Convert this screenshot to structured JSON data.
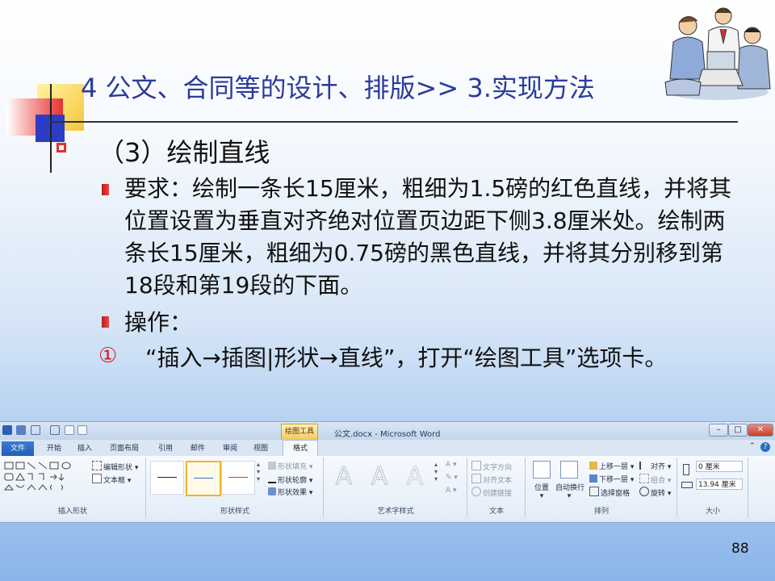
{
  "slide": {
    "title": "4 公文、合同等的设计、排版>> 3.实现方法",
    "heading": "（3）绘制直线",
    "requirement": "要求：绘制一条长15厘米，粗细为1.5磅的红色直线，并将其位置设置为垂直对齐绝对位置页边距下侧3.8厘米处。绘制两条长15厘米，粗细为0.75磅的黑色直线，并将其分别移到第18段和第19段的下面。",
    "operation_label": "操作：",
    "step_number": "①",
    "step_text": "“插入→插图|形状→直线”，打开“绘图工具”选项卡。",
    "page_number": "88",
    "colors": {
      "title": "#2a3c9a",
      "bullet": "#e0322c"
    }
  },
  "word": {
    "window_title": "公文.docx - Microsoft Word",
    "contextual_tab": "绘图工具",
    "window_buttons": [
      "–",
      "□",
      "✕"
    ],
    "tabs": {
      "file": "文件",
      "items": [
        "开始",
        "插入",
        "页面布局",
        "引用",
        "邮件",
        "审阅",
        "视图"
      ],
      "format": "格式"
    },
    "groups": {
      "insert_shapes": {
        "label": "插入形状",
        "edit_shape": "编辑形状",
        "text_box": "文本框"
      },
      "shape_styles": {
        "label": "形状样式",
        "fill": "形状填充",
        "outline": "形状轮廓",
        "effects": "形状效果"
      },
      "wordart": {
        "label": "艺术字样式",
        "glyph": "A"
      },
      "text": {
        "label": "文本",
        "direction": "文字方向",
        "align": "对齐文本",
        "link": "创建链接"
      },
      "arrange": {
        "label": "排列",
        "position": "位置",
        "wrap": "自动换行",
        "bring_forward": "上移一层",
        "send_backward": "下移一层",
        "selection_pane": "选择窗格",
        "align": "对齐",
        "group": "组合",
        "rotate": "旋转"
      },
      "size": {
        "label": "大小",
        "height": "0 厘米",
        "width": "13.94 厘米"
      }
    }
  }
}
